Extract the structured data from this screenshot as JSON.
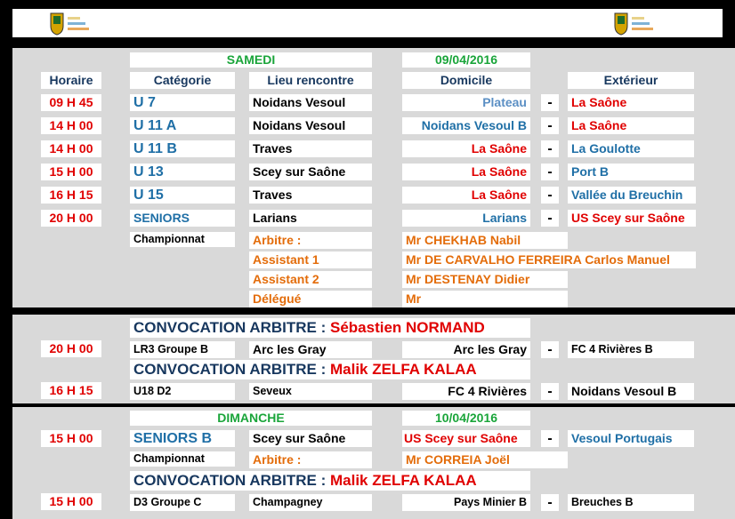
{
  "saturday": {
    "day": "SAMEDI",
    "date": "09/04/2016",
    "headers": {
      "time": "Horaire",
      "category": "Catégorie",
      "venue": "Lieu rencontre",
      "home": "Domicile",
      "away": "Extérieur"
    },
    "matches": [
      {
        "time": "09 H 45",
        "category": "U 7",
        "venue": "Noidans Vesoul",
        "home": "Plateau",
        "away": "La Saône"
      },
      {
        "time": "14 H 00",
        "category": "U 11 A",
        "venue": "Noidans Vesoul",
        "home": "Noidans Vesoul B",
        "away": "La Saône"
      },
      {
        "time": "14 H 00",
        "category": "U 11 B",
        "venue": "Traves",
        "home": "La Saône",
        "away": "La Goulotte"
      },
      {
        "time": "15 H 00",
        "category": "U 13",
        "venue": "Scey sur Saône",
        "home": "La Saône",
        "away": "Port B"
      },
      {
        "time": "16 H 15",
        "category": "U 15",
        "venue": "Traves",
        "home": "La Saône",
        "away": "Vallée du Breuchin"
      },
      {
        "time": "20 H 00",
        "category": "SENIORS",
        "venue": "Larians",
        "home": "Larians",
        "away": "US Scey sur Saône"
      }
    ],
    "dash": "-",
    "competition": "Championnat",
    "officials": [
      {
        "role": "Arbitre :",
        "name": "Mr CHEKHAB Nabil"
      },
      {
        "role": "Assistant 1",
        "name": "Mr DE CARVALHO FERREIRA Carlos Manuel"
      },
      {
        "role": "Assistant 2",
        "name": "Mr DESTENAY Didier"
      },
      {
        "role": "Délégué",
        "name": "Mr"
      }
    ]
  },
  "convocations": [
    {
      "label": "CONVOCATION ARBITRE : ",
      "referee": "Sébastien NORMAND",
      "time": "20 H 00",
      "category": "LR3 Groupe B",
      "venue": "Arc les Gray",
      "home": "Arc les Gray",
      "away": "FC 4 Rivières B"
    },
    {
      "label": "CONVOCATION ARBITRE : ",
      "referee": "Malik ZELFA KALAA",
      "time": "16 H 15",
      "category": "U18 D2",
      "venue": "Seveux",
      "home": "FC 4 Rivières",
      "away": "Noidans Vesoul B"
    }
  ],
  "sunday": {
    "day": "DIMANCHE",
    "date": "10/04/2016",
    "match": {
      "time": "15 H 00",
      "category": "SENIORS B",
      "venue": "Scey sur Saône",
      "home": "US Scey sur Saône",
      "away": "Vesoul Portugais"
    },
    "competition": "Championnat",
    "referee_role": "Arbitre :",
    "referee_name": "Mr CORREIA Joël",
    "convocation": {
      "label": "CONVOCATION ARBITRE : ",
      "referee": "Malik ZELFA KALAA",
      "time": "15 H 00",
      "category": "D3 Groupe C",
      "venue": "Champagney",
      "home": "Pays Minier B",
      "away": "Breuches B"
    }
  },
  "colors": {
    "red": "#e00000",
    "blue": "#1f6fa6",
    "green": "#1aa53a",
    "orange": "#e36c0a",
    "panel": "#d9d9d9"
  }
}
